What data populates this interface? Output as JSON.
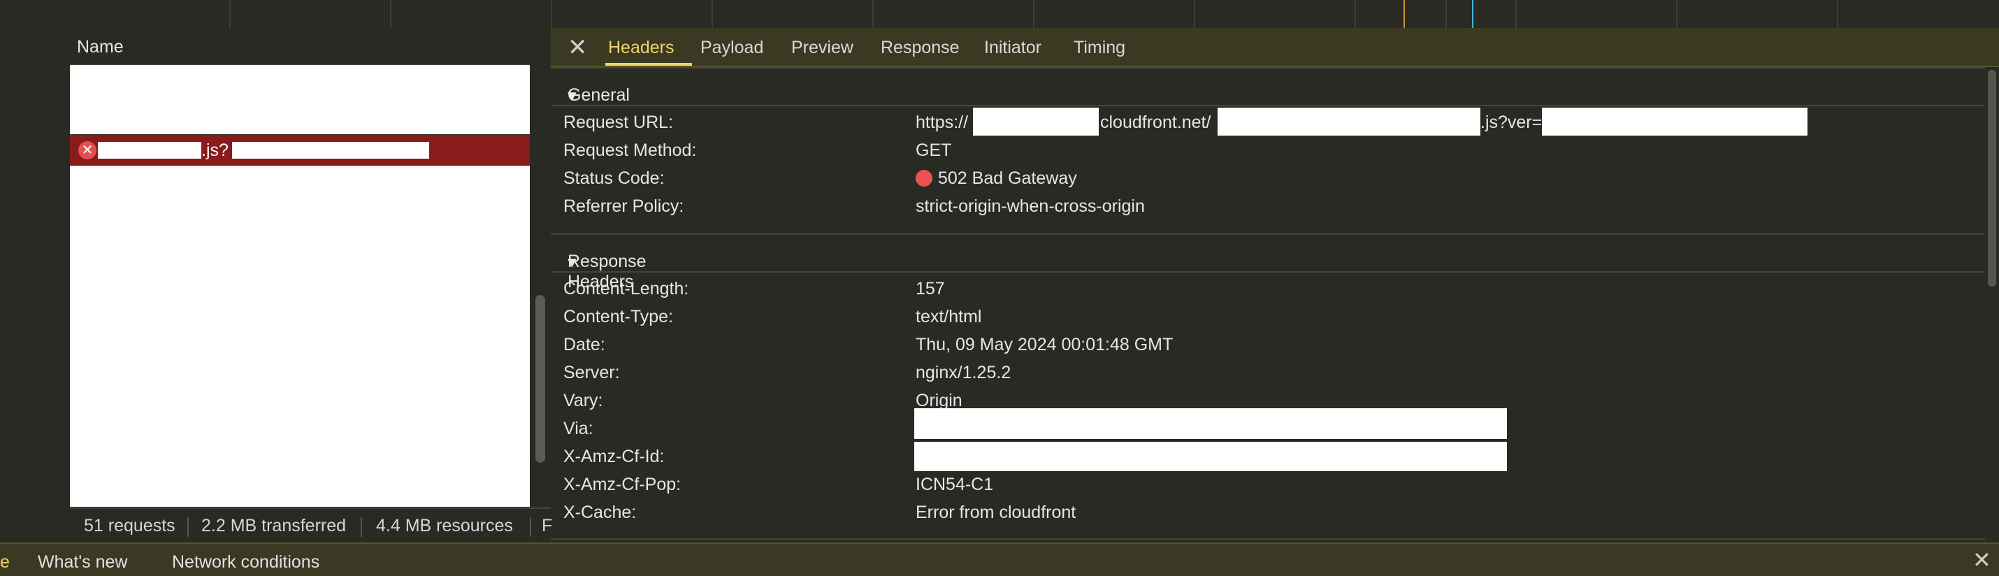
{
  "name_panel": {
    "header": "Name",
    "error_row_mid": ".js?",
    "error_icon": "close-circle-icon"
  },
  "status_bar": {
    "requests": "51 requests",
    "transferred": "2.2 MB transferred",
    "resources": "4.4 MB resources",
    "finish": "F"
  },
  "drawer": {
    "partial": "e",
    "tab1": "What's new",
    "tab2": "Network conditions",
    "close_icon": "close-icon"
  },
  "tabs": {
    "close_icon": "close-icon",
    "headers": "Headers",
    "payload": "Payload",
    "preview": "Preview",
    "response": "Response",
    "initiator": "Initiator",
    "timing": "Timing"
  },
  "general": {
    "title": "General",
    "request_url_key": "Request URL:",
    "request_url_prefix": "https://",
    "request_url_mid": "cloudfront.net/",
    "request_url_suffix": ".js?ver=",
    "method_key": "Request Method:",
    "method_val": "GET",
    "status_key": "Status Code:",
    "status_val": "502 Bad Gateway",
    "status_color": "#ea5252",
    "referrer_key": "Referrer Policy:",
    "referrer_val": "strict-origin-when-cross-origin"
  },
  "response_headers": {
    "title": "Response Headers",
    "content_length_key": "Content-Length:",
    "content_length_val": "157",
    "content_type_key": "Content-Type:",
    "content_type_val": "text/html",
    "date_key": "Date:",
    "date_val": "Thu, 09 May 2024 00:01:48 GMT",
    "server_key": "Server:",
    "server_val": "nginx/1.25.2",
    "vary_key": "Vary:",
    "vary_val": "Origin",
    "via_key": "Via:",
    "amz_id_key": "X-Amz-Cf-Id:",
    "amz_pop_key": "X-Amz-Cf-Pop:",
    "amz_pop_val": "ICN54-C1",
    "cache_key": "X-Cache:",
    "cache_val": "Error from cloudfront"
  }
}
